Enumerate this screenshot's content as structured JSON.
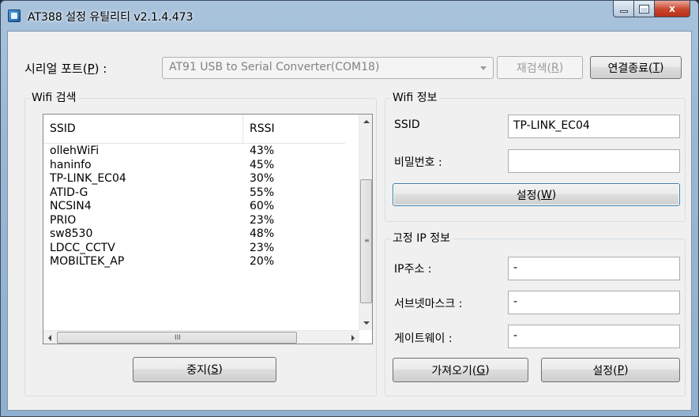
{
  "window": {
    "title": "AT388 설정 유틸리티 v2.1.4.473",
    "close_glyph": "x"
  },
  "serial": {
    "label_prefix": "시리얼 포트(",
    "label_key": "P",
    "label_suffix": ") :",
    "port_value": "AT91 USB to Serial Converter(COM18)",
    "rescan": {
      "prefix": "재검색(",
      "key": "R",
      "suffix": ")"
    },
    "disconnect": {
      "prefix": "연결종료(",
      "key": "T",
      "suffix": ")"
    }
  },
  "wifi_scan": {
    "group_title": "Wifi 검색",
    "columns": {
      "ssid": "SSID",
      "rssi": "RSSI"
    },
    "rows": [
      {
        "ssid": "ollehWiFi",
        "rssi": "43%"
      },
      {
        "ssid": "haninfo",
        "rssi": "45%"
      },
      {
        "ssid": "TP-LINK_EC04",
        "rssi": "30%"
      },
      {
        "ssid": "ATID-G",
        "rssi": "55%"
      },
      {
        "ssid": "NCSIN4",
        "rssi": "60%"
      },
      {
        "ssid": "PRIO",
        "rssi": "23%"
      },
      {
        "ssid": "sw8530",
        "rssi": "48%"
      },
      {
        "ssid": "LDCC_CCTV",
        "rssi": "23%"
      },
      {
        "ssid": "MOBILTEK_AP",
        "rssi": "20%"
      }
    ],
    "hscroll_grip": "III",
    "vscroll_grip": "≡",
    "stop_button": {
      "prefix": "중지(",
      "key": "S",
      "suffix": ")"
    }
  },
  "wifi_info": {
    "group_title": "Wifi 정보",
    "ssid_label": "SSID",
    "ssid_value": "TP-LINK_EC04",
    "password_label": "비밀번호 :",
    "password_value": "",
    "set_button": {
      "prefix": "설정(",
      "key": "W",
      "suffix": ")"
    }
  },
  "static_ip": {
    "group_title": "고정 IP 정보",
    "ip_label": "IP주소 :",
    "ip_value": "-",
    "subnet_label": "서브넷마스크 :",
    "subnet_value": "-",
    "gateway_label": "게이트웨이 :",
    "gateway_value": "-",
    "fetch_button": {
      "prefix": "가져오기(",
      "key": "G",
      "suffix": ")"
    },
    "set_button": {
      "prefix": "설정(",
      "key": "P",
      "suffix": ")"
    }
  }
}
